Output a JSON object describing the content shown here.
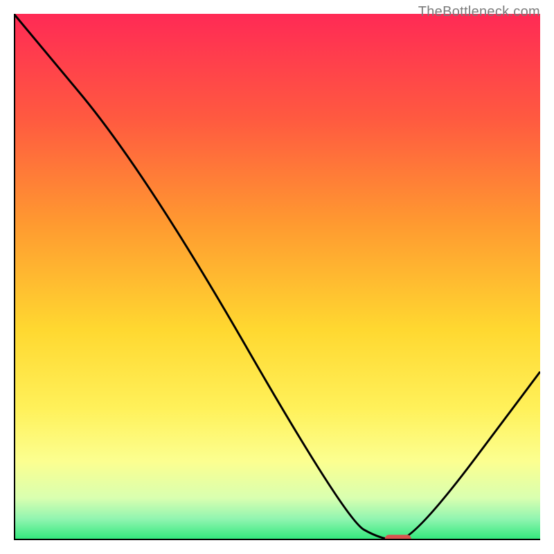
{
  "watermark": "TheBottleneck.com",
  "chart_data": {
    "type": "line",
    "title": "",
    "xlabel": "",
    "ylabel": "",
    "xlim": [
      0,
      100
    ],
    "ylim": [
      0,
      100
    ],
    "gradient_stops": [
      {
        "offset": 0,
        "color": "#ff2a55"
      },
      {
        "offset": 20,
        "color": "#ff5a40"
      },
      {
        "offset": 40,
        "color": "#ff9a30"
      },
      {
        "offset": 60,
        "color": "#ffd830"
      },
      {
        "offset": 75,
        "color": "#fff15a"
      },
      {
        "offset": 85,
        "color": "#fcff90"
      },
      {
        "offset": 92,
        "color": "#d9ffb0"
      },
      {
        "offset": 96,
        "color": "#90f5b0"
      },
      {
        "offset": 100,
        "color": "#2ee87a"
      }
    ],
    "curve_points": [
      {
        "x": 0,
        "y": 100
      },
      {
        "x": 25,
        "y": 70
      },
      {
        "x": 63,
        "y": 4
      },
      {
        "x": 70,
        "y": 0
      },
      {
        "x": 76,
        "y": 0
      },
      {
        "x": 100,
        "y": 32
      }
    ],
    "marker": {
      "x": 73,
      "y": 0,
      "width": 5,
      "height": 1.5,
      "color": "#d9534f"
    },
    "axes_color": "#000000"
  }
}
